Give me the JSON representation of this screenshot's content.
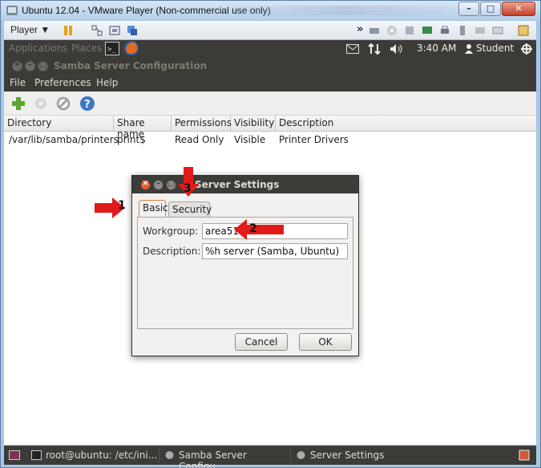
{
  "window": {
    "title": "Ubuntu 12.04 - VMware Player (Non-commercial use only)",
    "minimize": "–",
    "maximize": "□",
    "close": "✕"
  },
  "player_bar": {
    "menu_label": "Player ▼"
  },
  "ubuntu_panel": {
    "applications": "Applications",
    "places": "Places",
    "time": "3:40 AM",
    "user": "Student"
  },
  "samba": {
    "title": "Samba Server Configuration",
    "menus": [
      "File",
      "Preferences",
      "Help"
    ],
    "columns": [
      "Directory",
      "Share name",
      "Permissions",
      "Visibility",
      "Description"
    ],
    "rows": [
      [
        "/var/lib/samba/printers",
        "print$",
        "Read Only",
        "Visible",
        "Printer Drivers"
      ]
    ]
  },
  "taskbar": {
    "items": [
      "root@ubuntu: /etc/ini...",
      "Samba Server Configu...",
      "Server Settings"
    ]
  },
  "dialog": {
    "title": "Server Settings",
    "tabs": [
      "Basic",
      "Security"
    ],
    "workgroup_label": "Workgroup:",
    "workgroup_value": "area51",
    "description_label": "Description:",
    "description_value": "%h server (Samba, Ubuntu)",
    "cancel_label": "Cancel",
    "ok_label": "OK"
  },
  "annotations": [
    "1",
    "2",
    "3"
  ],
  "colors": {
    "ubuntu_panel": "#3c3b37",
    "annotation_red": "#e21a1a",
    "active_tab_outline": "#e07a3b"
  },
  "icons": [
    "vmware-icon",
    "pause-icon",
    "firefox-icon",
    "terminal-icon",
    "add-icon",
    "gear-icon",
    "block-icon",
    "help-icon",
    "mail-icon",
    "network-icon",
    "volume-icon",
    "user-icon",
    "power-icon"
  ]
}
